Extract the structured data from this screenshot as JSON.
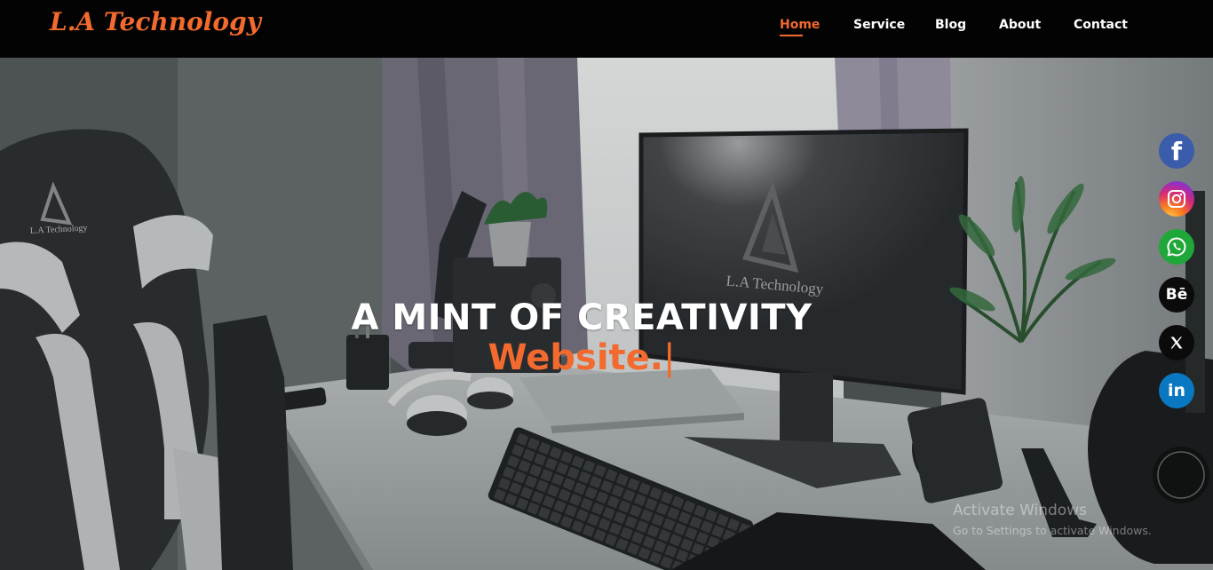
{
  "brand": {
    "name": "L.A Technology",
    "color": "#f26a2e"
  },
  "nav": {
    "items": [
      {
        "label": "Home",
        "active": true
      },
      {
        "label": "Service",
        "active": false
      },
      {
        "label": "Blog",
        "active": false
      },
      {
        "label": "About",
        "active": false
      },
      {
        "label": "Contact",
        "active": false
      }
    ]
  },
  "hero": {
    "title": "A MINT OF CREATIVITY",
    "typed_text": "Website.",
    "cursor": "|",
    "scene_labels": {
      "chair_logo": "L.A Technology",
      "monitor_logo": "L.A Technology"
    }
  },
  "social": [
    {
      "name": "facebook",
      "icon": "facebook-icon",
      "glyph": "f",
      "color": "#3b5bab"
    },
    {
      "name": "instagram",
      "icon": "instagram-icon",
      "color": "#d62976"
    },
    {
      "name": "whatsapp",
      "icon": "whatsapp-icon",
      "color": "#1fa739"
    },
    {
      "name": "behance",
      "icon": "behance-icon",
      "glyph": "Bē",
      "color": "#0b0b0b"
    },
    {
      "name": "x",
      "icon": "x-icon",
      "glyph": "𝕏",
      "color": "#0b0b0b"
    },
    {
      "name": "linkedin",
      "icon": "linkedin-icon",
      "glyph": "in",
      "color": "#0a78c0"
    }
  ],
  "watermark": {
    "title": "Activate Windows",
    "subtitle": "Go to Settings to activate Windows."
  }
}
